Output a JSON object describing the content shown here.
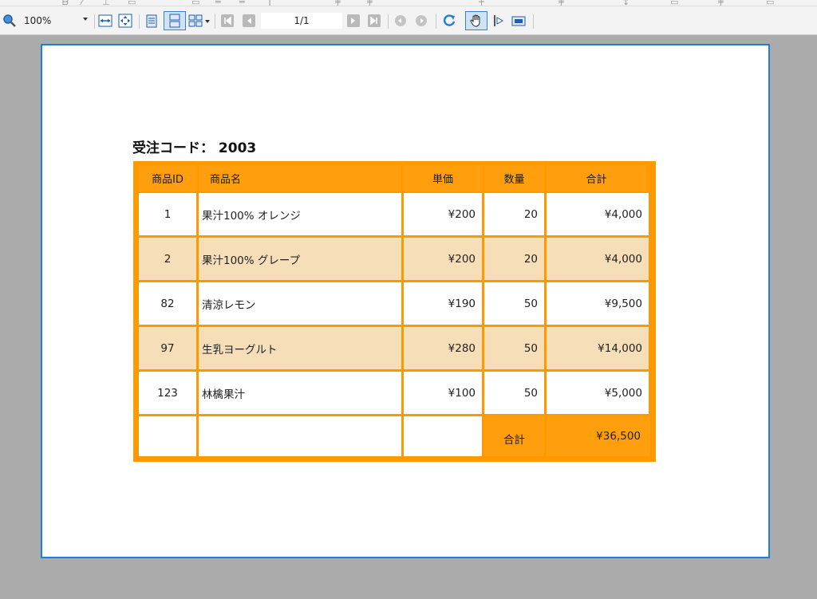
{
  "toolbar": {
    "zoom_value": "100%",
    "page_indicator": "1/1",
    "icons": [
      "zoom-magnifier-icon",
      "fit-width-icon",
      "fit-page-icon",
      "single-page-icon",
      "continuous-page-icon",
      "multi-page-icon",
      "first-page-icon",
      "previous-page-icon",
      "next-page-icon",
      "last-page-icon",
      "back-icon",
      "forward-icon",
      "refresh-icon",
      "hand-tool-icon",
      "text-select-icon",
      "snapshot-icon"
    ]
  },
  "report": {
    "heading": "受注コード： 2003",
    "columns": [
      "商品ID",
      "商品名",
      "単価",
      "数量",
      "合計"
    ],
    "rows": [
      {
        "id": "1",
        "name": "果汁100% オレンジ",
        "price": "¥200",
        "qty": "20",
        "total": "¥4,000",
        "shaded": false
      },
      {
        "id": "2",
        "name": "果汁100% グレープ",
        "price": "¥200",
        "qty": "20",
        "total": "¥4,000",
        "shaded": true
      },
      {
        "id": "82",
        "name": "清涼レモン",
        "price": "¥190",
        "qty": "50",
        "total": "¥9,500",
        "shaded": false
      },
      {
        "id": "97",
        "name": "生乳ヨーグルト",
        "price": "¥280",
        "qty": "50",
        "total": "¥14,000",
        "shaded": true
      },
      {
        "id": "123",
        "name": "林檎果汁",
        "price": "¥100",
        "qty": "50",
        "total": "¥5,000",
        "shaded": false
      }
    ],
    "footer": {
      "label": "合計",
      "total": "¥36,500"
    }
  },
  "colors": {
    "accent_orange": "#ff9900",
    "row_shaded": "#f5deb8",
    "row_plain": "#ffffff",
    "page_border": "#1f7fd6",
    "background": "#ababab"
  }
}
